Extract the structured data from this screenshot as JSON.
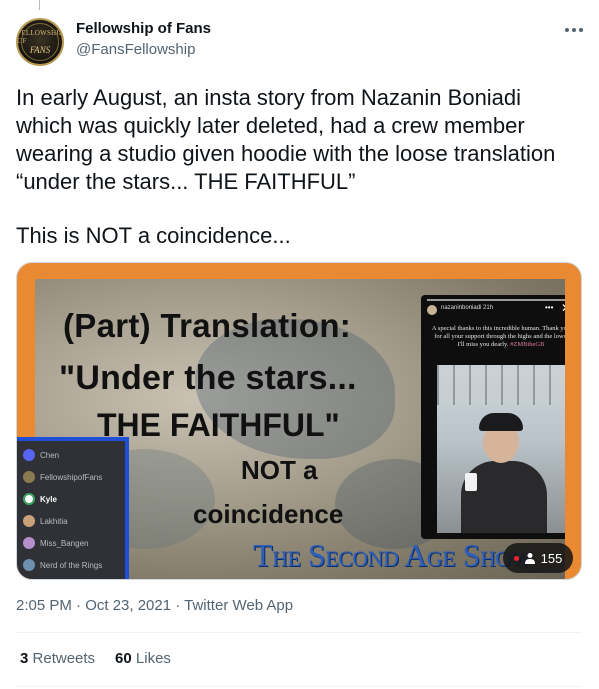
{
  "account": {
    "display_name": "Fellowship of Fans",
    "handle": "@FansFellowship",
    "avatar_text_line1": "FELLOWSHIP OF",
    "avatar_text_line2": "FANS"
  },
  "tweet": {
    "text": "In early August, an insta story from Nazanin Boniadi which was quickly later deleted, had a crew member wearing a studio given hoodie with the loose translation “under the stars... THE FAITHFUL”",
    "text_second": "This is NOT a coincidence...",
    "timestamp": "2:05 PM · Oct 23, 2021 · Twitter Web App",
    "stats": {
      "retweets_count": "3",
      "retweets_label": "Retweets",
      "likes_count": "60",
      "likes_label": "Likes"
    }
  },
  "media": {
    "line1": "(Part) Translation:",
    "line2": "\"Under the stars...",
    "line3": "THE FAITHFUL\"",
    "line4": "NOT a",
    "line5": "coincidence",
    "brand": "The Second Age Show",
    "viewer_count": "155",
    "story": {
      "username": "nazaninboniadi",
      "time": "21h",
      "text": "A special thanks to this incredible human. Thank you for all your support through the highs and the lows. I'll miss you dearly.",
      "tag": "#ZMBtheGB"
    },
    "discord_users": [
      "Chen",
      "FellowshipofFans",
      "Kyle",
      "Lakhitia",
      "Miss_Bangen",
      "Nerd of the Rings"
    ]
  },
  "colors": {
    "media_border": "#e98a32",
    "brand_text": "#2e5fb8",
    "discord_accent": "#1f4fd6",
    "text_primary": "#0f1419",
    "text_secondary": "#536471"
  },
  "icons": {
    "more": "more-icon",
    "person": "person-icon",
    "record": "record-dot-icon"
  }
}
